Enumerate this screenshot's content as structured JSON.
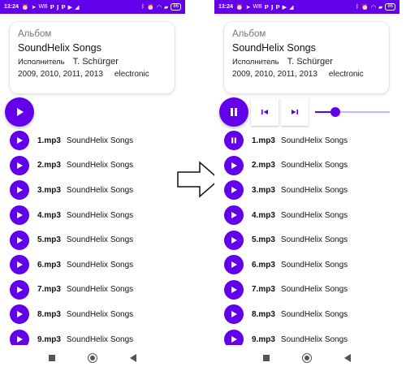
{
  "colors": {
    "accent": "#6200ea",
    "accent_light": "#cdb4f7",
    "statusbar_text": "#ffffff"
  },
  "screens": [
    {
      "status": {
        "time": "13:24",
        "notif_text": "WB",
        "battery": "86"
      },
      "card": {
        "caption": "Альбом",
        "title": "SoundHelix Songs",
        "artist_label": "Исполнитель",
        "artist": "T. Schürger",
        "years": "2009, 2010, 2011, 2013",
        "genre": "electronic"
      },
      "player": {
        "state": "stopped",
        "main_icon": "play-icon"
      },
      "tracks": [
        {
          "file": "1.mp3",
          "album": "SoundHelix Songs",
          "icon": "play-icon"
        },
        {
          "file": "2.mp3",
          "album": "SoundHelix Songs",
          "icon": "play-icon"
        },
        {
          "file": "3.mp3",
          "album": "SoundHelix Songs",
          "icon": "play-icon"
        },
        {
          "file": "4.mp3",
          "album": "SoundHelix Songs",
          "icon": "play-icon"
        },
        {
          "file": "5.mp3",
          "album": "SoundHelix Songs",
          "icon": "play-icon"
        },
        {
          "file": "6.mp3",
          "album": "SoundHelix Songs",
          "icon": "play-icon"
        },
        {
          "file": "7.mp3",
          "album": "SoundHelix Songs",
          "icon": "play-icon"
        },
        {
          "file": "8.mp3",
          "album": "SoundHelix Songs",
          "icon": "play-icon"
        },
        {
          "file": "9.mp3",
          "album": "SoundHelix Songs",
          "icon": "play-icon"
        }
      ]
    },
    {
      "status": {
        "time": "13:24",
        "notif_text": "WB",
        "battery": "86"
      },
      "card": {
        "caption": "Альбом",
        "title": "SoundHelix Songs",
        "artist_label": "Исполнитель",
        "artist": "T. Schürger",
        "years": "2009, 2010, 2011, 2013",
        "genre": "electronic"
      },
      "player": {
        "state": "playing",
        "main_icon": "pause-icon",
        "prev_icon": "skip-previous-icon",
        "next_icon": "skip-next-icon",
        "progress": 0.27
      },
      "tracks": [
        {
          "file": "1.mp3",
          "album": "SoundHelix Songs",
          "icon": "pause-icon"
        },
        {
          "file": "2.mp3",
          "album": "SoundHelix Songs",
          "icon": "play-icon"
        },
        {
          "file": "3.mp3",
          "album": "SoundHelix Songs",
          "icon": "play-icon"
        },
        {
          "file": "4.mp3",
          "album": "SoundHelix Songs",
          "icon": "play-icon"
        },
        {
          "file": "5.mp3",
          "album": "SoundHelix Songs",
          "icon": "play-icon"
        },
        {
          "file": "6.mp3",
          "album": "SoundHelix Songs",
          "icon": "play-icon"
        },
        {
          "file": "7.mp3",
          "album": "SoundHelix Songs",
          "icon": "play-icon"
        },
        {
          "file": "8.mp3",
          "album": "SoundHelix Songs",
          "icon": "play-icon"
        },
        {
          "file": "9.mp3",
          "album": "SoundHelix Songs",
          "icon": "play-icon"
        }
      ]
    }
  ],
  "transition_icon": "right-arrow-icon"
}
